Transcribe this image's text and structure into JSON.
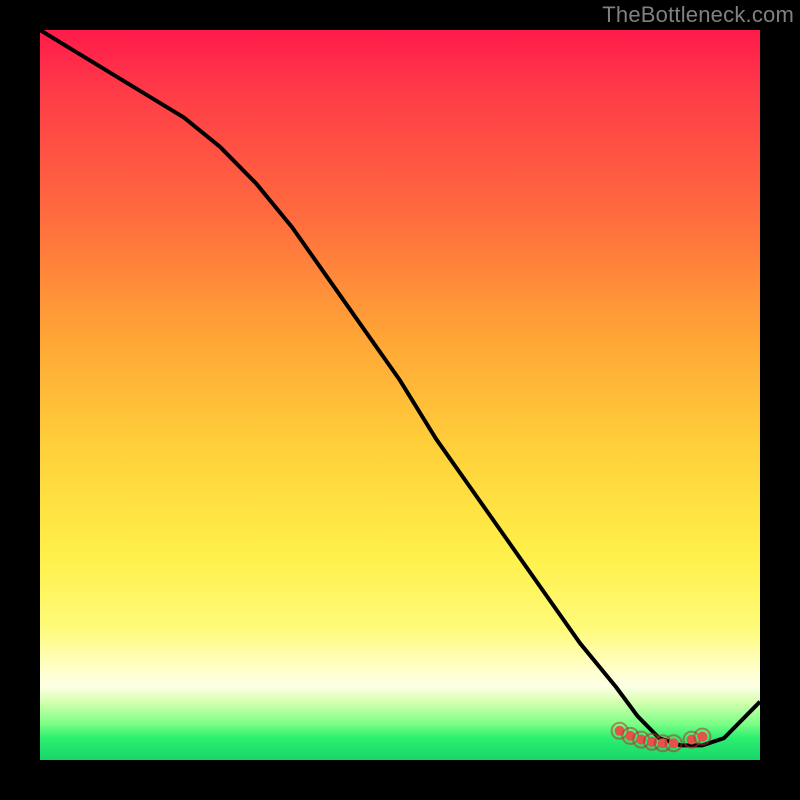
{
  "attribution": "TheBottleneck.com",
  "colors": {
    "page_bg": "#000000",
    "attribution_text": "#808080",
    "curve": "#000000",
    "marker_fill": "#e4524a",
    "marker_ring": "#b4322d"
  },
  "chart_data": {
    "type": "line",
    "title": "",
    "xlabel": "",
    "ylabel": "",
    "xlim": [
      0,
      100
    ],
    "ylim": [
      0,
      100
    ],
    "series": [
      {
        "name": "bottleneck-curve",
        "x": [
          0,
          5,
          10,
          15,
          20,
          25,
          30,
          35,
          40,
          45,
          50,
          55,
          60,
          65,
          70,
          75,
          80,
          83,
          86,
          89,
          92,
          95,
          100
        ],
        "values": [
          100,
          97,
          94,
          91,
          88,
          84,
          79,
          73,
          66,
          59,
          52,
          44,
          37,
          30,
          23,
          16,
          10,
          6,
          3,
          2,
          2,
          3,
          8
        ]
      }
    ],
    "marker_cluster": {
      "name": "sweet-spot",
      "x": [
        80.5,
        82.0,
        83.5,
        85.0,
        86.5,
        88.0,
        90.5,
        92.0
      ],
      "values": [
        4.0,
        3.3,
        2.8,
        2.5,
        2.3,
        2.3,
        2.8,
        3.2
      ]
    }
  }
}
